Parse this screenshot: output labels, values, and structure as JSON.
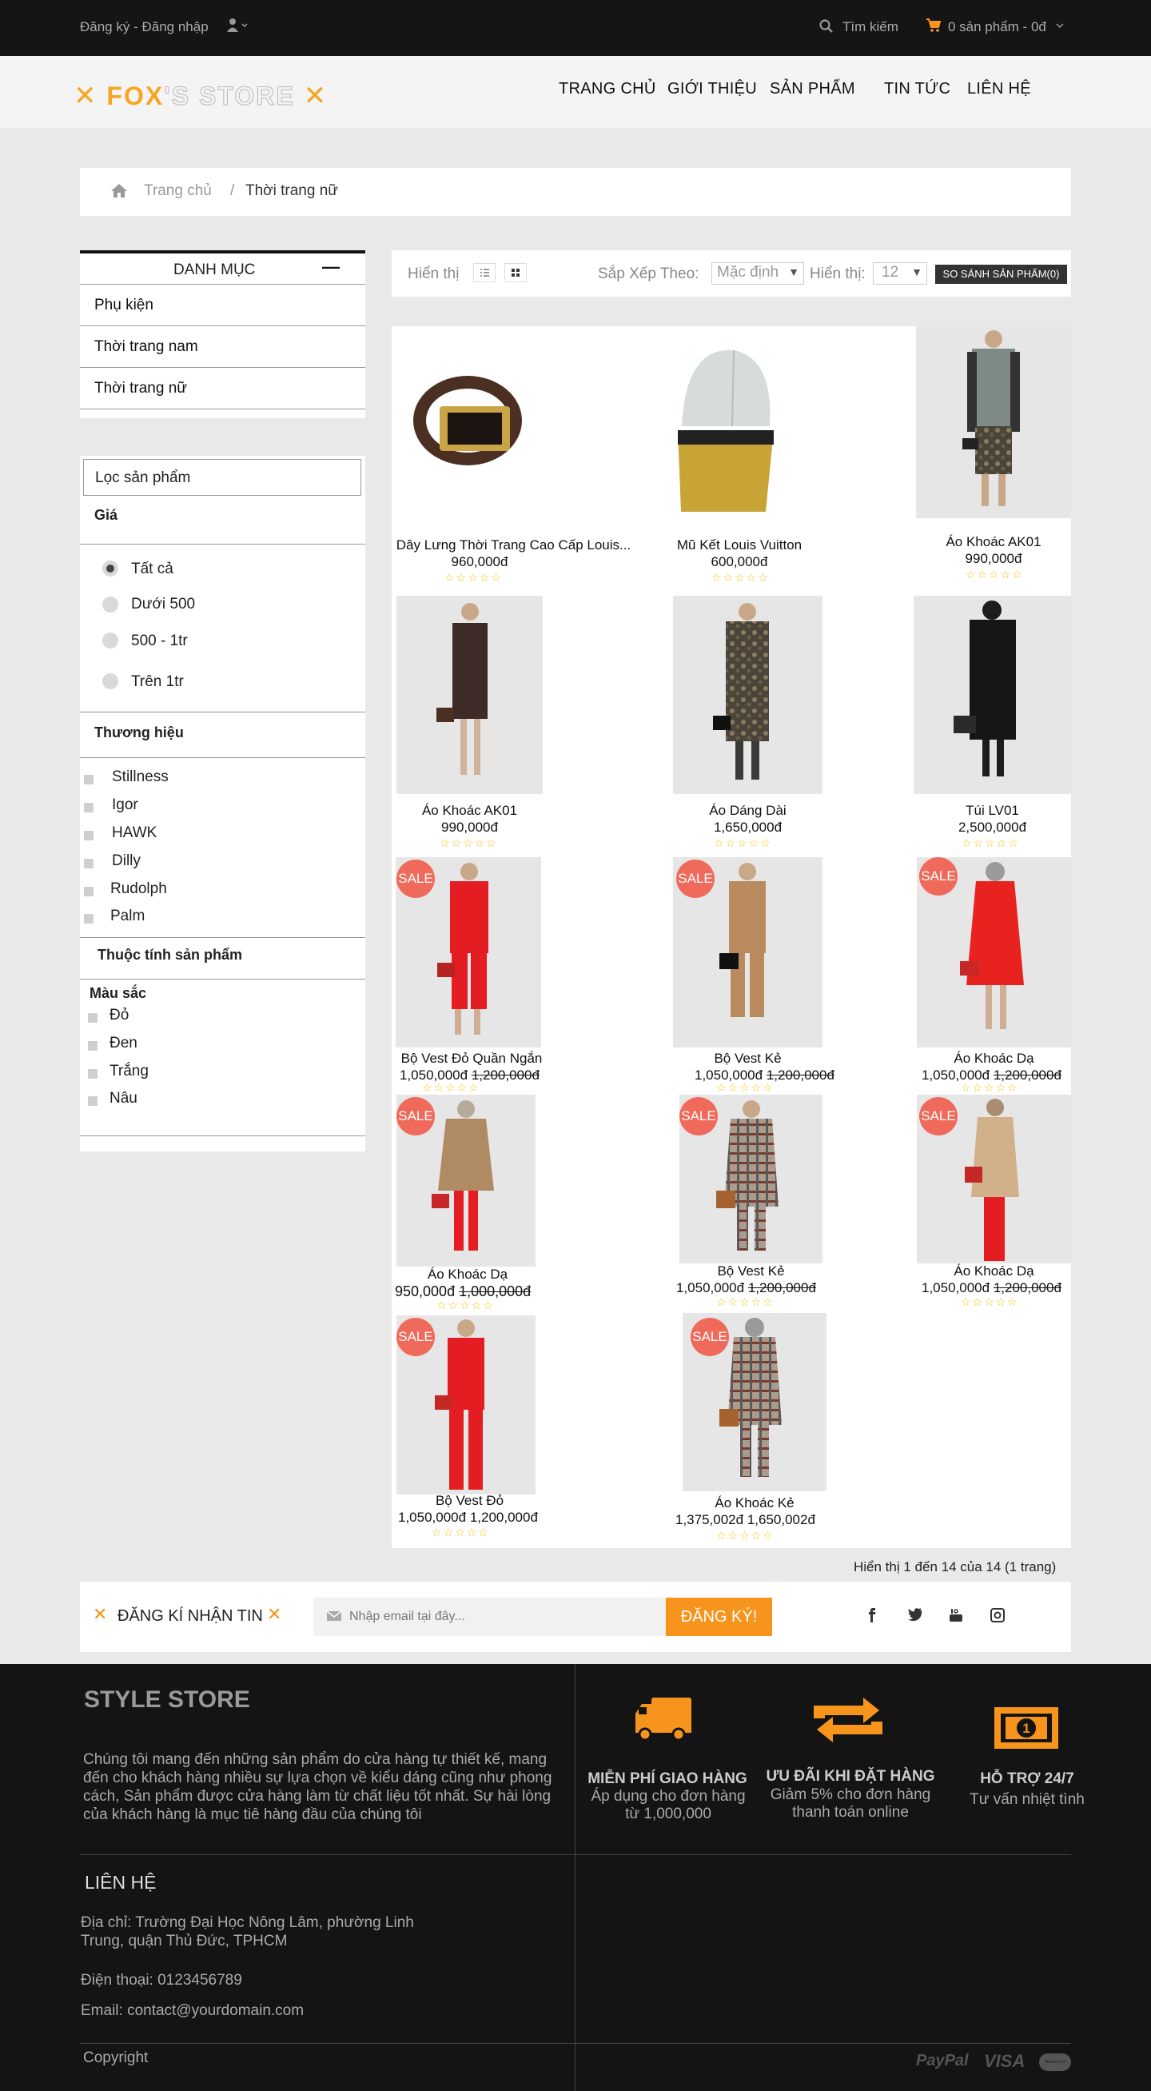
{
  "topbar": {
    "account_link": "Đăng ký - Đăng nhập",
    "search_label": "Tìm kiếm",
    "cart_label": "0 sản phẩm - 0đ"
  },
  "header": {
    "logo_fox": "FOX",
    "logo_rest": "'S STORE",
    "nav": [
      "TRANG CHỦ",
      "GIỚI THIỆU",
      "SẢN PHẨM",
      "TIN TỨC",
      "LIÊN HỆ"
    ]
  },
  "breadcrumb": {
    "home": "Trang chủ",
    "separator": "/",
    "current": "Thời trang nữ"
  },
  "sidebar": {
    "category_title": "DANH MỤC",
    "collapse_symbol": "—",
    "categories": [
      "Phụ kiện",
      "Thời trang nam",
      "Thời trang nữ"
    ],
    "filter_title": "Lọc sản phẩm",
    "price_title": "Giá",
    "price_options": [
      "Tất cả",
      "Dưới 500",
      "500 - 1tr",
      "Trên 1tr"
    ],
    "brand_title": "Thương hiệu",
    "brands": [
      "Stillness",
      "Igor",
      "HAWK",
      "Dilly",
      "Rudolph",
      "Palm"
    ],
    "attr_title": "Thuộc tính sản phẩm",
    "color_title": "Màu sắc",
    "colors": [
      "Đỏ",
      "Đen",
      "Trắng",
      "Nâu"
    ]
  },
  "toolbar": {
    "view_label": "Hiển thị",
    "sort_label": "Sắp Xếp Theo:",
    "sort_value": "Mặc định",
    "show_label": "Hiển thị:",
    "show_value": "12",
    "compare_label": "SO SÁNH SẢN PHẨM(0)"
  },
  "products": [
    {
      "name": "Dây Lưng Thời Trang Cao Cấp Louis...",
      "price": "960,000đ",
      "old_price": "",
      "sale": false,
      "stars": "☆☆☆☆☆"
    },
    {
      "name": "Mũ Kết Louis Vuitton",
      "price": "600,000đ",
      "old_price": "",
      "sale": false,
      "stars": "☆☆☆☆☆"
    },
    {
      "name": "Áo Khoác AK01",
      "price": "990,000đ",
      "old_price": "",
      "sale": false,
      "stars": "☆☆☆☆☆"
    },
    {
      "name": "Áo Khoác AK01",
      "price": "990,000đ",
      "old_price": "",
      "sale": false,
      "stars": "☆☆☆☆☆"
    },
    {
      "name": "Áo Dáng Dài",
      "price": "1,650,000đ",
      "old_price": "",
      "sale": false,
      "stars": "☆☆☆☆☆"
    },
    {
      "name": "Túi LV01",
      "price": "2,500,000đ",
      "old_price": "",
      "sale": false,
      "stars": "☆☆☆☆☆"
    },
    {
      "name": "Bộ Vest Đỏ Quần Ngắn",
      "price": "1,050,000đ",
      "old_price": "1,200,000đ",
      "sale": true,
      "stars": "☆☆☆☆☆"
    },
    {
      "name": "Bộ Vest Kẻ",
      "price": "1,050,000đ",
      "old_price": "1,200,000đ",
      "sale": true,
      "stars": "☆☆☆☆☆"
    },
    {
      "name": "Áo Khoác Dạ",
      "price": "1,050,000đ",
      "old_price": "1,200,000đ",
      "sale": true,
      "stars": "☆☆☆☆☆"
    },
    {
      "name": "Áo Khoác Dạ",
      "price": "950,000đ",
      "old_price": "1,000,000đ",
      "sale": true,
      "stars": "☆☆☆☆☆"
    },
    {
      "name": "Bộ Vest Kẻ",
      "price": "1,050,000đ",
      "old_price": "1,200,000đ",
      "sale": true,
      "stars": "☆☆☆☆☆"
    },
    {
      "name": "Áo Khoác Dạ",
      "price": "1,050,000đ",
      "old_price": "1,200,000đ",
      "sale": true,
      "stars": "☆☆☆☆☆"
    },
    {
      "name": "Bộ Vest Đỏ",
      "price": "1,050,000đ",
      "old_price": "1,200,000đ",
      "sale": true,
      "stars": "☆☆☆☆☆"
    },
    {
      "name": "Áo Khoác Kẻ",
      "price": "1,375,002đ",
      "old_price": "1,650,002đ",
      "sale": true,
      "stars": "☆☆☆☆☆"
    }
  ],
  "sale_label": "SALE",
  "pagination": "Hiển thị 1 đến 14 của 14 (1 trang)",
  "newsletter": {
    "title": "ĐĂNG KÍ NHẬN TIN",
    "placeholder": "Nhập email tại đây...",
    "button": "ĐĂNG KÝ!"
  },
  "footer": {
    "store_title": "STYLE STORE",
    "store_desc": "Chúng tôi mang đến những sản phẩm do cửa hàng tự thiết kế, mang đến cho khách hàng nhiều sự lựa chọn về kiểu dáng cũng như phong cách, Sản phẩm được cửa hàng làm từ chất liệu tốt nhất. Sự hài lòng của khách hàng là mục tiê hàng đầu của chúng tôi",
    "features": [
      {
        "title": "MIỄN PHÍ GIAO HÀNG",
        "desc": "Áp dụng cho đơn hàng từ 1,000,000"
      },
      {
        "title": "ƯU ĐÃI KHI ĐẶT HÀNG",
        "desc": "Giảm 5% cho đơn hàng thanh toán online"
      },
      {
        "title": "HỖ TRỢ 24/7",
        "desc": "Tư vấn nhiệt tình"
      }
    ],
    "contact_title": "LIÊN HỆ",
    "address": "Địa chỉ: Trường Đại Học Nông Lâm, phường Linh Trung, quận Thủ Đức, TPHCM",
    "phone": "Điện thoại: 0123456789",
    "email": "Email: contact@yourdomain.com",
    "copyright": "Copyright",
    "payments": [
      "PayPal",
      "VISA",
      "MasterCard"
    ]
  },
  "colors": {
    "accent": "#f7941d",
    "sale": "#ef6a5a",
    "dark": "#141414"
  }
}
